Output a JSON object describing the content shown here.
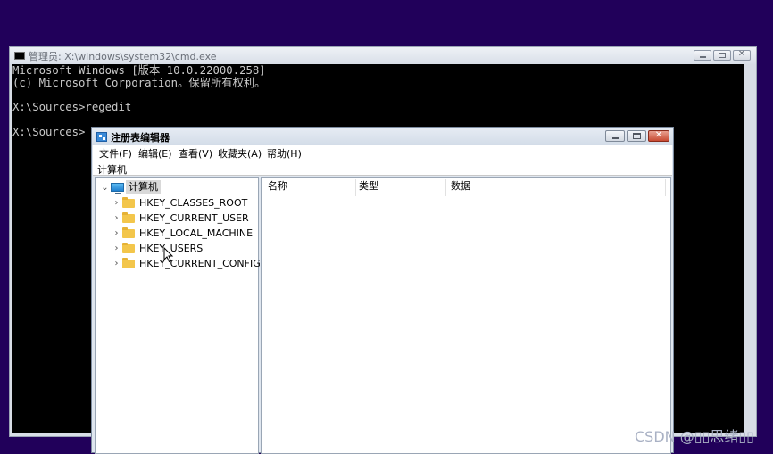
{
  "cmd": {
    "title": "管理员: X:\\windows\\system32\\cmd.exe",
    "lines": [
      "Microsoft Windows [版本 10.0.22000.258]",
      "(c) Microsoft Corporation。保留所有权利。",
      "",
      "X:\\Sources>regedit",
      "",
      "X:\\Sources>"
    ]
  },
  "regedit": {
    "title": "注册表编辑器",
    "menu": [
      "文件(F)",
      "编辑(E)",
      "查看(V)",
      "收藏夹(A)",
      "帮助(H)"
    ],
    "address": "计算机",
    "tree": {
      "root": "计算机",
      "hives": [
        "HKEY_CLASSES_ROOT",
        "HKEY_CURRENT_USER",
        "HKEY_LOCAL_MACHINE",
        "HKEY_USERS",
        "HKEY_CURRENT_CONFIG"
      ]
    },
    "columns": [
      "名称",
      "类型",
      "数据"
    ]
  },
  "watermark": "CSDN @▯▯思绪▯▯",
  "colors": {
    "desktop": "#21005a",
    "console_bg": "#000000",
    "console_text": "#c9c9c9",
    "close_button": "#c84a32"
  },
  "icons": {
    "cmd_app": "console-icon",
    "regedit_app": "regedit-icon",
    "root": "computer-icon",
    "hive": "folder-icon"
  }
}
